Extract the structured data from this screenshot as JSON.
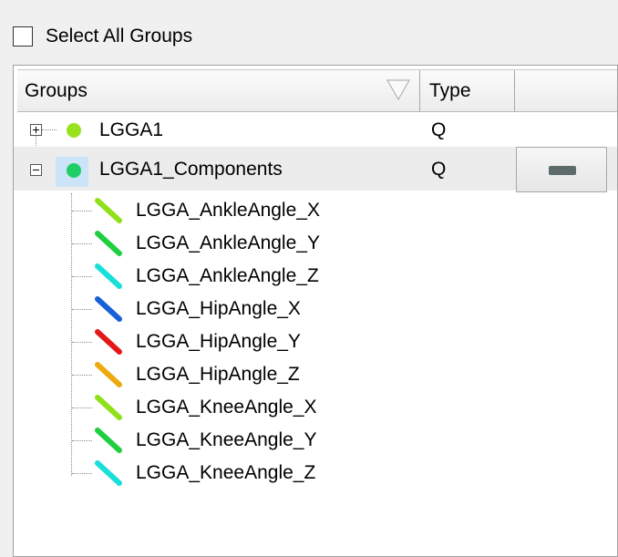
{
  "select_all": {
    "label": "Select All Groups",
    "checked": false
  },
  "header": {
    "groups": "Groups",
    "type": "Type"
  },
  "groups": [
    {
      "label": "LGGA1",
      "type": "Q",
      "expanded": false,
      "color": "#99e21e"
    },
    {
      "label": "LGGA1_Components",
      "type": "Q",
      "expanded": true,
      "color": "#1fcf65",
      "selected": true,
      "button_color": "#5d6b6b"
    }
  ],
  "children": [
    {
      "label": "LGGA_AnkleAngle_X",
      "color": "#8fe01a",
      "icon": "line-segment-icon"
    },
    {
      "label": "LGGA_AnkleAngle_Y",
      "color": "#1fcf40",
      "icon": "line-segment-icon"
    },
    {
      "label": "LGGA_AnkleAngle_Z",
      "color": "#18e0d8",
      "icon": "line-segment-icon"
    },
    {
      "label": "LGGA_HipAngle_X",
      "color": "#1660d8",
      "icon": "line-segment-icon"
    },
    {
      "label": "LGGA_HipAngle_Y",
      "color": "#e41818",
      "icon": "line-segment-icon"
    },
    {
      "label": "LGGA_HipAngle_Z",
      "color": "#ecaa10",
      "icon": "line-segment-icon"
    },
    {
      "label": "LGGA_KneeAngle_X",
      "color": "#8fe01a",
      "icon": "line-segment-icon"
    },
    {
      "label": "LGGA_KneeAngle_Y",
      "color": "#1fcf40",
      "icon": "line-segment-icon"
    },
    {
      "label": "LGGA_KneeAngle_Z",
      "color": "#18e0d8",
      "icon": "line-segment-icon"
    }
  ]
}
